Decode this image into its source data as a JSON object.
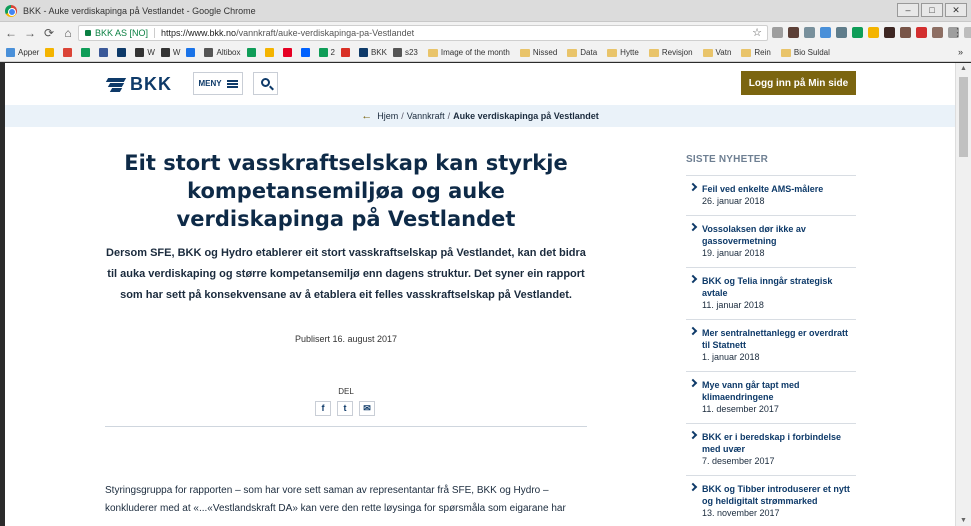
{
  "window": {
    "title": "BKK - Auke verdiskapinga på Vestlandet - Google Chrome",
    "controls": [
      "–",
      "□",
      "✕"
    ]
  },
  "addressbar": {
    "secure_label": "BKK AS [NO]",
    "url_prefix": "https://www.bkk.no",
    "url_path": "/vannkraft/auke-verdiskapinga-pa-Vestlandet"
  },
  "bookmarks": [
    {
      "label": "Apper",
      "color": "#4a90d9"
    },
    {
      "label": "",
      "color": "#f4b400"
    },
    {
      "label": "",
      "color": "#db4437"
    },
    {
      "label": "",
      "color": "#0f9d58"
    },
    {
      "label": "",
      "color": "#3b5998"
    },
    {
      "label": "",
      "color": "#0e3a69"
    },
    {
      "label": "W",
      "color": "#333333"
    },
    {
      "label": "W",
      "color": "#333333"
    },
    {
      "label": "",
      "color": "#1a73e8"
    },
    {
      "label": "Altibox",
      "color": "#555555"
    },
    {
      "label": "",
      "color": "#0f9d58"
    },
    {
      "label": "",
      "color": "#f4b400"
    },
    {
      "label": "",
      "color": "#e60023"
    },
    {
      "label": "",
      "color": "#0061fe"
    },
    {
      "label": "2",
      "color": "#0f9d58"
    },
    {
      "label": "",
      "color": "#d93025"
    },
    {
      "label": "BKK",
      "color": "#0e3a69"
    },
    {
      "label": "s23",
      "color": "#555555"
    }
  ],
  "bookmark_folders": [
    "Image of the month",
    "Nissed",
    "Data",
    "Hytte",
    "Revisjon",
    "Vatn",
    "Rein",
    "Bio Suldal"
  ],
  "header": {
    "logo_text": "BKK",
    "menu_label": "MENY",
    "login_label": "Logg inn på Min side"
  },
  "breadcrumb": {
    "items": [
      "Hjem",
      "Vannkraft"
    ],
    "current": "Auke verdiskapinga på Vestlandet"
  },
  "article": {
    "headline": "Eit stort vasskraftselskap kan styrkje kompetansemiljøa og auke verdiskapinga på Vestlandet",
    "lead": "Dersom SFE, BKK og Hydro etablerer eit stort vasskraftselskap på Vestlandet, kan det bidra til auka verdiskaping og større kompetansemiljø enn dagens struktur. Det syner ein rapport som har sett på konsekvensane av å etablera eit felles vasskraftselskap på Vestlandet.",
    "published": "Publisert 16. august 2017",
    "share_label": "DEL",
    "body": "Styringsgruppa for rapporten – som har vore sett saman av representantar frå SFE, BKK og Hydro – konkluderer med at «...«Vestlandskraft DA» kan vere den rette løysinga for spørsmåla som eigarane har"
  },
  "sidebar": {
    "title": "SISTE NYHETER",
    "news": [
      {
        "title": "Feil ved enkelte AMS-målere",
        "date": "26. januar 2018"
      },
      {
        "title": "Vossolaksen dør ikke av gassovermetning",
        "date": "19. januar 2018"
      },
      {
        "title": "BKK og Telia inngår strategisk avtale",
        "date": "11. januar 2018"
      },
      {
        "title": "Mer sentralnettanlegg er overdratt til Statnett",
        "date": "1. januar 2018"
      },
      {
        "title": "Mye vann går tapt med klimaendringene",
        "date": "11. desember 2017"
      },
      {
        "title": "BKK er i beredskap i forbindelse med uvær",
        "date": "7. desember 2017"
      },
      {
        "title": "BKK og Tibber introduserer et nytt og heldigitalt strømmarked",
        "date": "13. november 2017"
      }
    ]
  },
  "colors": {
    "brand_navy": "#0e3a69",
    "login_gold": "#7b6510",
    "breadcrumb_bg": "#eaf2f9"
  }
}
